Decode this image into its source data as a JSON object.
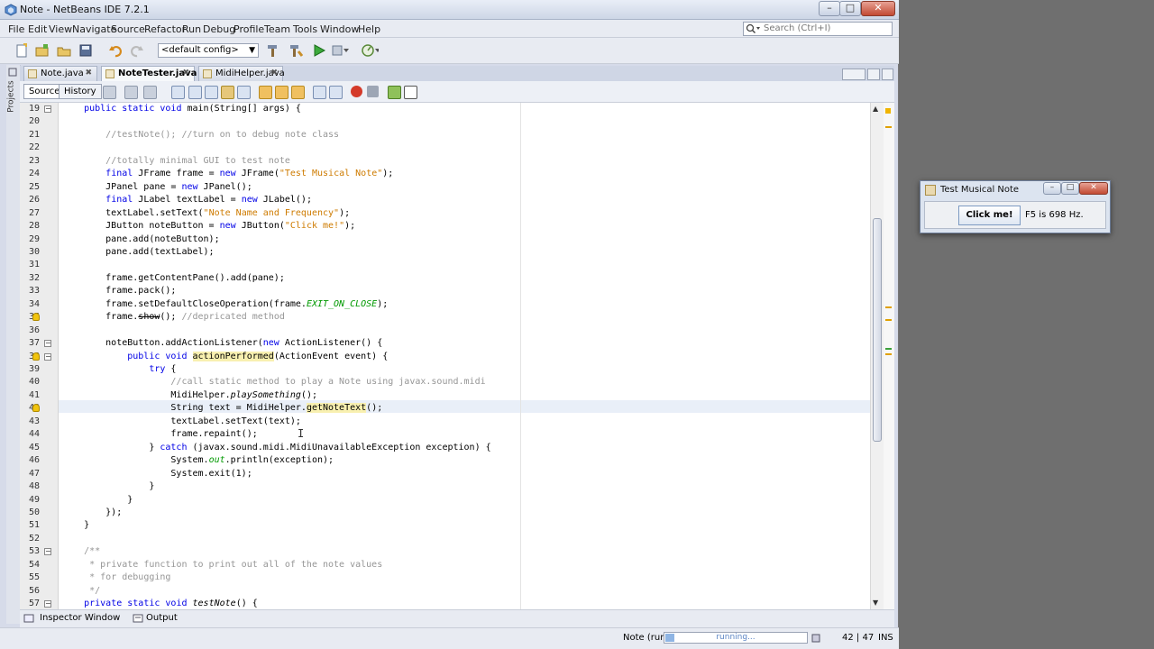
{
  "window": {
    "title": "Note - NetBeans IDE 7.2.1",
    "controls": {
      "minimize": "–",
      "maximize": "□",
      "close": "✕"
    }
  },
  "menu": [
    "File",
    "Edit",
    "View",
    "Navigate",
    "Source",
    "Refactor",
    "Run",
    "Debug",
    "Profile",
    "Team",
    "Tools",
    "Window",
    "Help"
  ],
  "search": {
    "placeholder": "Search (Ctrl+I)"
  },
  "toolbar": {
    "config": "<default config>"
  },
  "sidebar": {
    "projects_label": "Projects"
  },
  "tabs": [
    {
      "label": "Note.java",
      "active": false
    },
    {
      "label": "NoteTester.java",
      "active": true
    },
    {
      "label": "MidiHelper.java",
      "active": false
    }
  ],
  "editor_toolbar": {
    "source": "Source",
    "history": "History"
  },
  "editor": {
    "line_numbers": [
      "19",
      "20",
      "21",
      "22",
      "23",
      "24",
      "25",
      "26",
      "27",
      "28",
      "29",
      "30",
      "31",
      "32",
      "33",
      "34",
      "35",
      "36",
      "37",
      "38",
      "39",
      "40",
      "41",
      "42",
      "43",
      "44",
      "45",
      "46",
      "47",
      "48",
      "49",
      "50",
      "51",
      "52",
      "53",
      "54",
      "55",
      "56",
      "57"
    ],
    "lines": [
      [
        {
          "t": "    "
        },
        {
          "t": "public static void ",
          "c": "kw"
        },
        {
          "t": "main(String[] args) {"
        }
      ],
      [],
      [
        {
          "t": "        "
        },
        {
          "t": "//testNote(); //turn on to debug note class",
          "c": "cm"
        }
      ],
      [],
      [
        {
          "t": "        "
        },
        {
          "t": "//totally minimal GUI to test note",
          "c": "cm"
        }
      ],
      [
        {
          "t": "        "
        },
        {
          "t": "final ",
          "c": "kw"
        },
        {
          "t": "JFrame frame = "
        },
        {
          "t": "new ",
          "c": "kw"
        },
        {
          "t": "JFrame("
        },
        {
          "t": "\"Test Musical Note\"",
          "c": "str"
        },
        {
          "t": ");"
        }
      ],
      [
        {
          "t": "        JPanel pane = "
        },
        {
          "t": "new ",
          "c": "kw"
        },
        {
          "t": "JPanel();"
        }
      ],
      [
        {
          "t": "        "
        },
        {
          "t": "final ",
          "c": "kw"
        },
        {
          "t": "JLabel textLabel = "
        },
        {
          "t": "new ",
          "c": "kw"
        },
        {
          "t": "JLabel();"
        }
      ],
      [
        {
          "t": "        textLabel.setText("
        },
        {
          "t": "\"Note Name and Frequency\"",
          "c": "str"
        },
        {
          "t": ");"
        }
      ],
      [
        {
          "t": "        JButton noteButton = "
        },
        {
          "t": "new ",
          "c": "kw"
        },
        {
          "t": "JButton("
        },
        {
          "t": "\"Click me!\"",
          "c": "str"
        },
        {
          "t": ");"
        }
      ],
      [
        {
          "t": "        pane.add(noteButton);"
        }
      ],
      [
        {
          "t": "        pane.add(textLabel);"
        }
      ],
      [],
      [
        {
          "t": "        frame.getContentPane().add(pane);"
        }
      ],
      [
        {
          "t": "        frame.pack();"
        }
      ],
      [
        {
          "t": "        frame.setDefaultCloseOperation(frame."
        },
        {
          "t": "EXIT_ON_CLOSE",
          "c": "fld"
        },
        {
          "t": ");"
        }
      ],
      [
        {
          "t": "        frame."
        },
        {
          "t": "show",
          "c": "strike"
        },
        {
          "t": "(); "
        },
        {
          "t": "//depricated method",
          "c": "cm"
        }
      ],
      [],
      [
        {
          "t": "        noteButton.addActionListener("
        },
        {
          "t": "new ",
          "c": "kw"
        },
        {
          "t": "ActionListener() {"
        }
      ],
      [
        {
          "t": "            "
        },
        {
          "t": "public void ",
          "c": "kw"
        },
        {
          "t": "actionPerformed",
          "c": "hl"
        },
        {
          "t": "(ActionEvent event) {"
        }
      ],
      [
        {
          "t": "                "
        },
        {
          "t": "try ",
          "c": "kw"
        },
        {
          "t": "{"
        }
      ],
      [
        {
          "t": "                    "
        },
        {
          "t": "//call static method to play a Note using javax.sound.midi",
          "c": "cm"
        }
      ],
      [
        {
          "t": "                    MidiHelper."
        },
        {
          "t": "playSomething",
          "c": "it"
        },
        {
          "t": "();"
        }
      ],
      [
        {
          "t": "                    Stri"
        },
        {
          "t": "ng text = MidiHelper.",
          "c": "hlsel"
        },
        {
          "t": "getNoteText",
          "c": "hl"
        },
        {
          "t": "();"
        }
      ],
      [
        {
          "t": "                    textLabel.setText(text);"
        }
      ],
      [
        {
          "t": "                    frame.repaint();"
        }
      ],
      [
        {
          "t": "                } "
        },
        {
          "t": "catch ",
          "c": "kw"
        },
        {
          "t": "(javax.sound.midi.MidiUnavailableException exception) {"
        }
      ],
      [
        {
          "t": "                    System."
        },
        {
          "t": "out",
          "c": "fld"
        },
        {
          "t": ".println(exception);"
        }
      ],
      [
        {
          "t": "                    System.exit(1);"
        }
      ],
      [
        {
          "t": "                }"
        }
      ],
      [
        {
          "t": "            }"
        }
      ],
      [
        {
          "t": "        });"
        }
      ],
      [
        {
          "t": "    }"
        }
      ],
      [],
      [
        {
          "t": "    "
        },
        {
          "t": "/**",
          "c": "cm"
        }
      ],
      [
        {
          "t": "     "
        },
        {
          "t": "* private function to print out all of the note values",
          "c": "cm"
        }
      ],
      [
        {
          "t": "     "
        },
        {
          "t": "* for debugging",
          "c": "cm"
        }
      ],
      [
        {
          "t": "     "
        },
        {
          "t": "*/",
          "c": "cm"
        }
      ],
      [
        {
          "t": "    "
        },
        {
          "t": "private static void ",
          "c": "kw"
        },
        {
          "t": "testNote",
          "c": "it"
        },
        {
          "t": "() {"
        }
      ]
    ]
  },
  "bottom_tabs": {
    "inspector": "Inspector Window",
    "output": "Output"
  },
  "status": {
    "task": "Note (run)",
    "progress_text": "running...",
    "position": "42 | 47",
    "mode": "INS"
  },
  "dialog": {
    "title": "Test Musical Note",
    "button": "Click me!",
    "label": "F5 is 698 Hz."
  },
  "colors": {
    "keyword": "#0000e6",
    "string": "#ce7b00",
    "comment": "#969696",
    "accent": "#8fb5e4"
  }
}
